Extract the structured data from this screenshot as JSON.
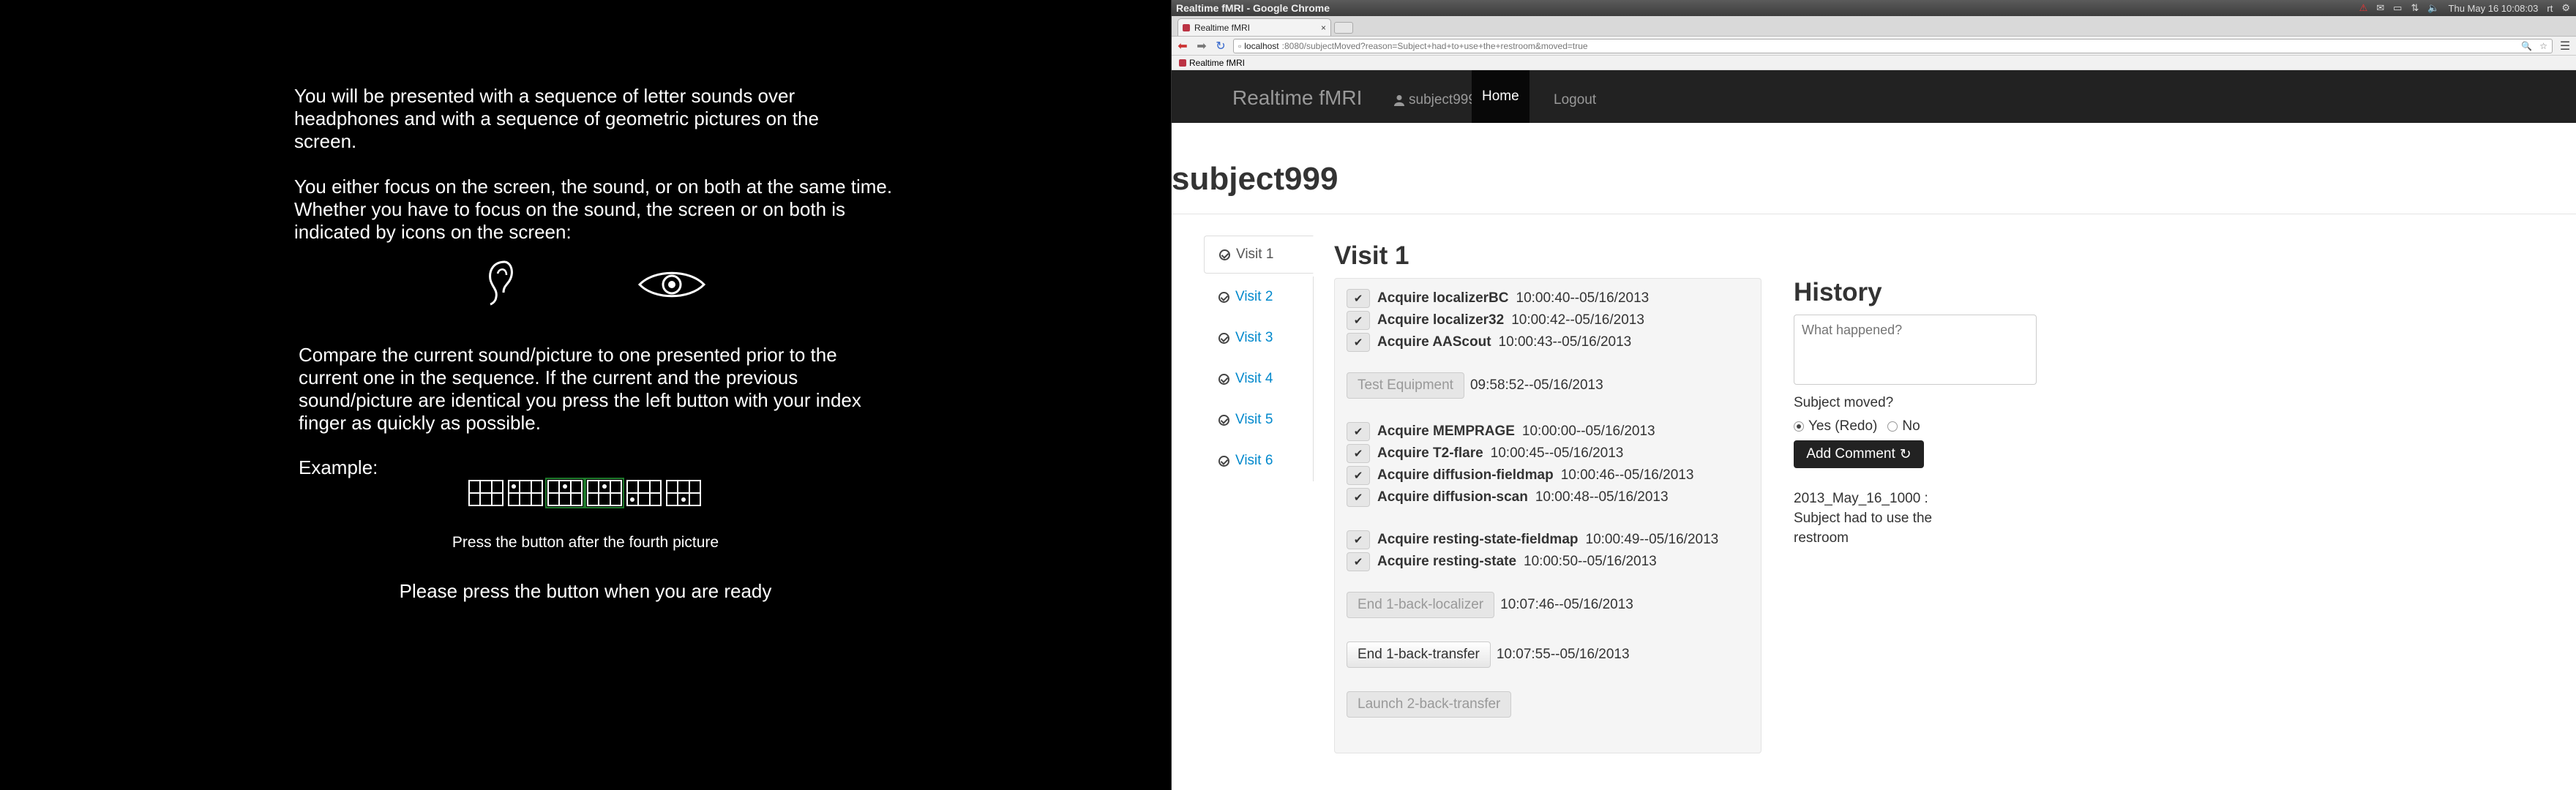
{
  "stimulus": {
    "para1": "You will be presented with a sequence of letter sounds over headphones and with a sequence of geometric pictures on the screen.",
    "para2": "You either focus on the screen, the sound, or on both at the same time. Whether you have to focus on the sound, the screen or on both is indicated by icons on the screen:",
    "icons": [
      "ear-icon",
      "eye-icon"
    ],
    "para3": "Compare the current sound/picture to one presented prior to the current one in the sequence. If the current and the previous sound/picture are identical you press the left button with your index finger as quickly as possible.",
    "example_label": "Example:",
    "example_caption": "Press the button after the fourth picture",
    "ready_prompt": "Please press the button when you are ready"
  },
  "window": {
    "title": "Realtime fMRI - Google Chrome",
    "clock": "Thu May 16 10:08:03",
    "user": "rt"
  },
  "tab": {
    "label": "Realtime fMRI",
    "close": "×"
  },
  "address": {
    "host": "localhost",
    "path": ":8080/subjectMoved?reason=Subject+had+to+use+the+restroom&moved=true"
  },
  "bookmarks": {
    "item": "Realtime fMRI"
  },
  "nav": {
    "brand": "Realtime fMRI",
    "user": "subject999",
    "home": "Home",
    "logout": "Logout"
  },
  "page": {
    "title": "subject999"
  },
  "visits": [
    "Visit 1",
    "Visit 2",
    "Visit 3",
    "Visit 4",
    "Visit 5",
    "Visit 6"
  ],
  "visit": {
    "title": "Visit 1",
    "group1": [
      {
        "name": "Acquire localizerBC",
        "time": "10:00:40--05/16/2013"
      },
      {
        "name": "Acquire localizer32",
        "time": "10:00:42--05/16/2013"
      },
      {
        "name": "Acquire AAScout",
        "time": "10:00:43--05/16/2013"
      }
    ],
    "test_equipment": {
      "label": "Test Equipment",
      "time": "09:58:52--05/16/2013"
    },
    "group2": [
      {
        "name": "Acquire MEMPRAGE",
        "time": "10:00:00--05/16/2013"
      },
      {
        "name": "Acquire T2-flare",
        "time": "10:00:45--05/16/2013"
      },
      {
        "name": "Acquire diffusion-fieldmap",
        "time": "10:00:46--05/16/2013"
      },
      {
        "name": "Acquire diffusion-scan",
        "time": "10:00:48--05/16/2013"
      }
    ],
    "group3": [
      {
        "name": "Acquire resting-state-fieldmap",
        "time": "10:00:49--05/16/2013"
      },
      {
        "name": "Acquire resting-state",
        "time": "10:00:50--05/16/2013"
      }
    ],
    "end_localizer": {
      "label": "End 1-back-localizer",
      "time": "10:07:46--05/16/2013"
    },
    "end_transfer": {
      "label": "End 1-back-transfer",
      "time": "10:07:55--05/16/2013"
    },
    "launch": {
      "label": "Launch 2-back-transfer"
    }
  },
  "history": {
    "title": "History",
    "placeholder": "What happened?",
    "moved_question": "Subject moved?",
    "yes": "Yes (Redo)",
    "no": "No",
    "yes_selected": true,
    "add_comment": "Add Comment",
    "entry": "2013_May_16_1000 : Subject had to use the restroom"
  }
}
